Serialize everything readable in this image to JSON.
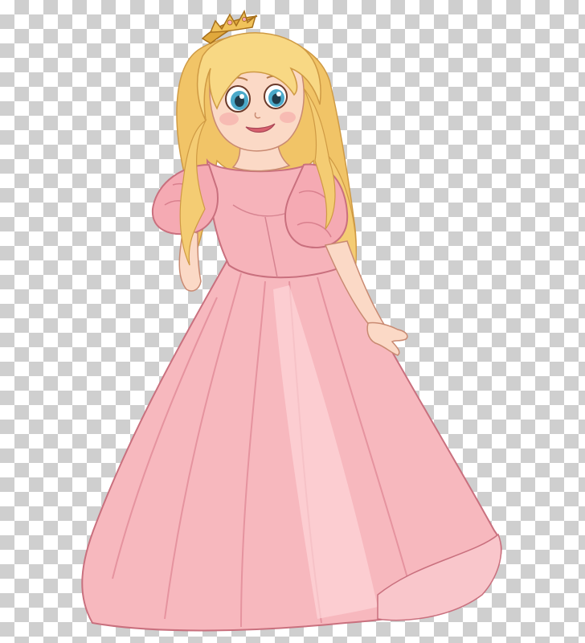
{
  "image": {
    "subject": "princess-illustration",
    "background_pattern": "transparency-checkerboard"
  },
  "colors": {
    "checker_light": "#ffffff",
    "checker_dark": "#cfcfcf",
    "hair": "#f6d37a",
    "hair_shadow": "#e2ae4c",
    "skin": "#fbd9c6",
    "dress": "#f7b9bf",
    "dress_shadow": "#e98e9a",
    "dress_light": "#fdd6d8",
    "tiara": "#e0a83c",
    "eyes": "#4aa9c9",
    "outline": "#b7705c"
  }
}
